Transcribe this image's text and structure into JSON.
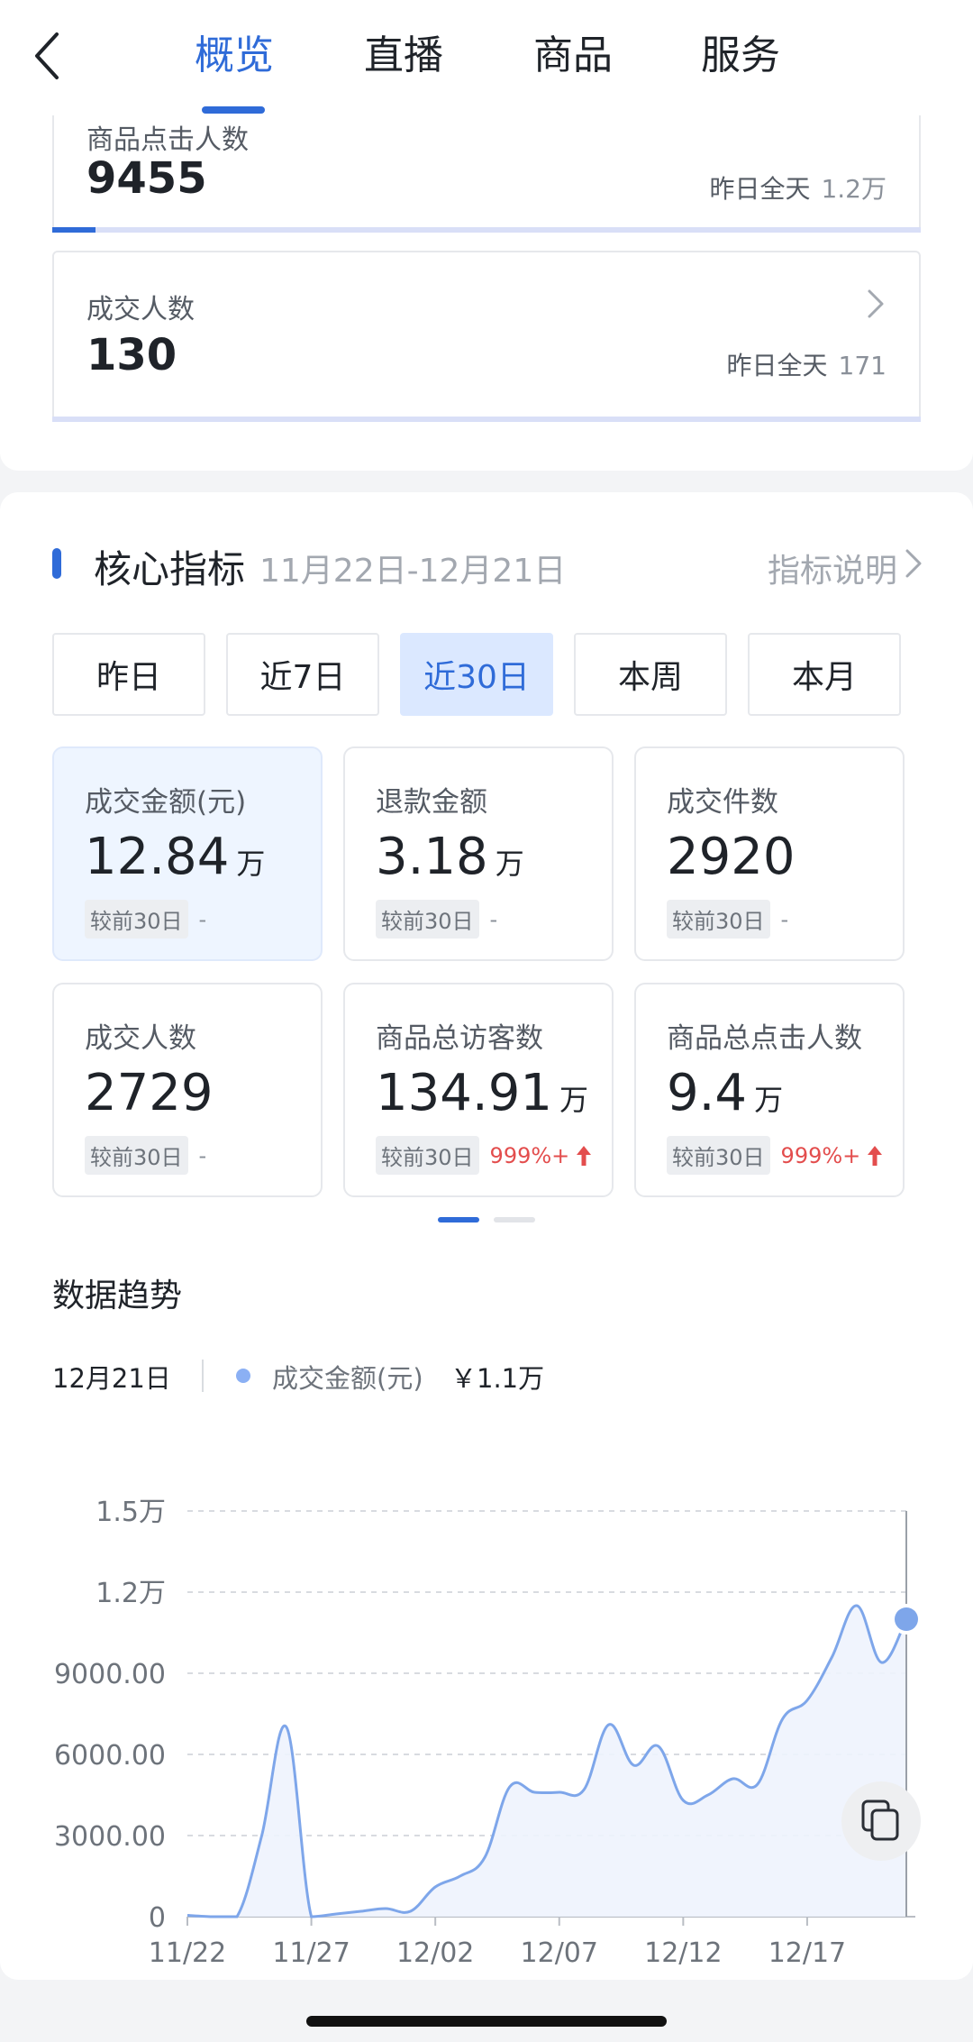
{
  "header": {
    "tabs": [
      {
        "label": "概览",
        "active": true
      },
      {
        "label": "直播",
        "active": false
      },
      {
        "label": "商品",
        "active": false
      },
      {
        "label": "服务",
        "active": false
      }
    ]
  },
  "top_metrics": [
    {
      "label": "商品点击人数",
      "value": "9455",
      "compare_label": "昨日全天",
      "compare_value": "1.2万",
      "progress": 0.05
    },
    {
      "label": "成交人数",
      "value": "130",
      "compare_label": "昨日全天",
      "compare_value": "171",
      "progress": 0.0
    }
  ],
  "core": {
    "title": "核心指标",
    "range": "11月22日-12月21日",
    "help": "指标说明",
    "periods": [
      {
        "label": "昨日",
        "active": false
      },
      {
        "label": "近7日",
        "active": false
      },
      {
        "label": "近30日",
        "active": true
      },
      {
        "label": "本周",
        "active": false
      },
      {
        "label": "本月",
        "active": false
      }
    ],
    "kpis": [
      {
        "label": "成交金额(元)",
        "value": "12.84",
        "unit": "万",
        "compare_tag": "较前30日",
        "change": "-",
        "up": false,
        "active": true
      },
      {
        "label": "退款金额",
        "value": "3.18",
        "unit": "万",
        "compare_tag": "较前30日",
        "change": "-",
        "up": false,
        "active": false
      },
      {
        "label": "成交件数",
        "value": "2920",
        "unit": "",
        "compare_tag": "较前30日",
        "change": "-",
        "up": false,
        "active": false
      },
      {
        "label": "成交人数",
        "value": "2729",
        "unit": "",
        "compare_tag": "较前30日",
        "change": "-",
        "up": false,
        "active": false
      },
      {
        "label": "商品总访客数",
        "value": "134.91",
        "unit": "万",
        "compare_tag": "较前30日",
        "change": "999%+",
        "up": true,
        "active": false
      },
      {
        "label": "商品总点击人数",
        "value": "9.4",
        "unit": "万",
        "compare_tag": "较前30日",
        "change": "999%+",
        "up": true,
        "active": false
      }
    ],
    "pager": {
      "pages": 2,
      "current": 1
    }
  },
  "trend": {
    "title": "数据趋势",
    "selected_date": "12月21日",
    "series_label": "成交金额(元)",
    "selected_value": "￥1.1万"
  },
  "colors": {
    "accent": "#2f6bd8",
    "series": "#7ea6ea",
    "up": "#e34d4d"
  },
  "icons": [
    "back-arrow-icon",
    "chevron-right-icon",
    "up-arrow-icon",
    "copy-icon"
  ],
  "chart_data": {
    "type": "area",
    "title": "",
    "xlabel": "",
    "ylabel": "",
    "y_tick_labels": [
      "0",
      "3000.00",
      "6000.00",
      "9000.00",
      "1.2万",
      "1.5万"
    ],
    "y_ticks": [
      0,
      3000,
      6000,
      9000,
      12000,
      15000
    ],
    "x_tick_labels": [
      "11/22",
      "11/27",
      "12/02",
      "12/07",
      "12/12",
      "12/17"
    ],
    "ylim": [
      0,
      15000
    ],
    "grid": true,
    "series": [
      {
        "name": "成交金额(元)",
        "x": [
          "11/22",
          "11/23",
          "11/24",
          "11/25",
          "11/26",
          "11/27",
          "11/28",
          "11/29",
          "11/30",
          "12/01",
          "12/02",
          "12/03",
          "12/04",
          "12/05",
          "12/06",
          "12/07",
          "12/08",
          "12/09",
          "12/10",
          "12/11",
          "12/12",
          "12/13",
          "12/14",
          "12/15",
          "12/16",
          "12/17",
          "12/18",
          "12/19",
          "12/20",
          "12/21"
        ],
        "values": [
          50,
          0,
          0,
          3000,
          7000,
          0,
          100,
          200,
          300,
          200,
          1100,
          1500,
          2200,
          4800,
          4600,
          4600,
          4700,
          7100,
          5600,
          6300,
          4300,
          4500,
          5100,
          4900,
          7300,
          8000,
          9600,
          11500,
          9400,
          11000
        ]
      }
    ],
    "highlight_index": 29
  }
}
